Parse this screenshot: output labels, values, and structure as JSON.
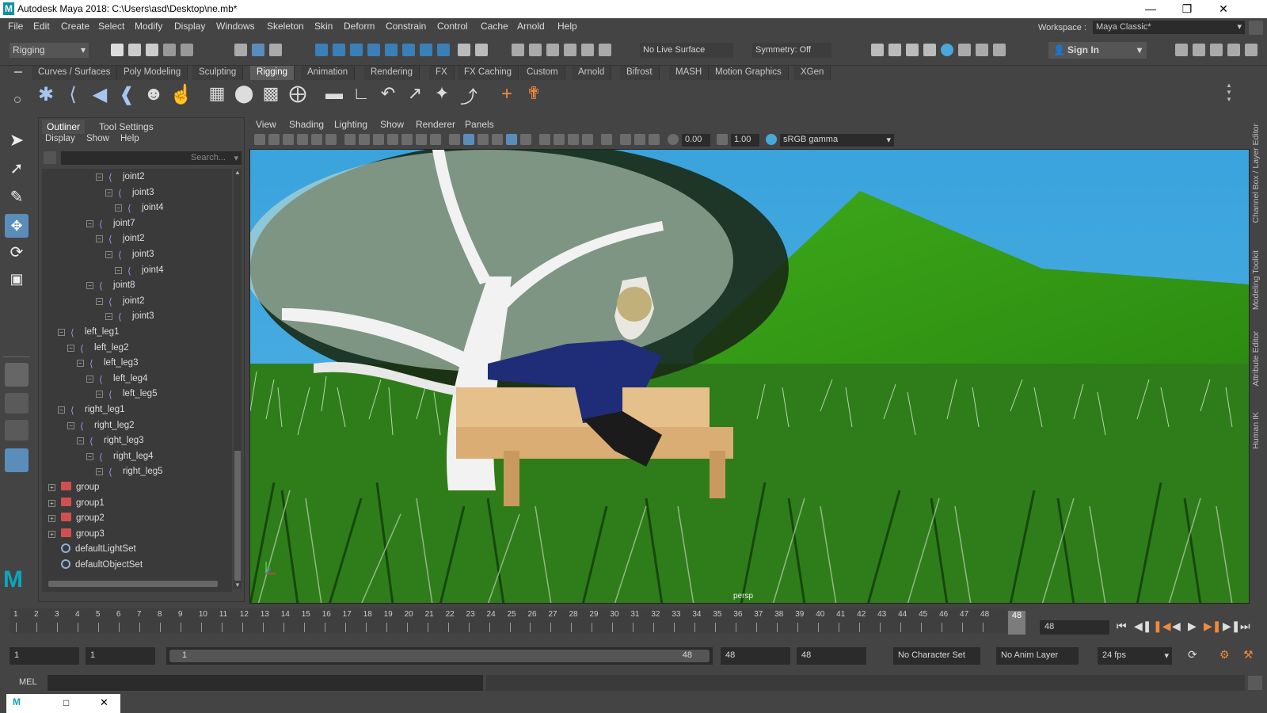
{
  "window": {
    "title": "Autodesk Maya 2018: C:\\Users\\asd\\Desktop\\ne.mb*",
    "logo": "M",
    "minimize_icon": "minimize-icon",
    "maximize_icon": "restore-icon",
    "close_icon": "close-icon"
  },
  "menubar": {
    "items": [
      "File",
      "Edit",
      "Create",
      "Select",
      "Modify",
      "Display",
      "Windows",
      "Skeleton",
      "Skin",
      "Deform",
      "Constrain",
      "Control",
      "Cache",
      "Arnold",
      "Help"
    ],
    "workspace_label": "Workspace :",
    "workspace_value": "Maya Classic*"
  },
  "statusline": {
    "mode": "Rigging",
    "live_surface": "No Live Surface",
    "symmetry": "Symmetry: Off",
    "sign_in": "Sign In"
  },
  "shelf": {
    "tabs": [
      "Curves / Surfaces",
      "Poly Modeling",
      "Sculpting",
      "Rigging",
      "Animation",
      "Rendering",
      "FX",
      "FX Caching",
      "Custom",
      "Arnold",
      "Bifrost",
      "MASH",
      "Motion Graphics",
      "XGen"
    ],
    "active_tab": "Rigging"
  },
  "outliner": {
    "tabs": [
      "Outliner",
      "Tool Settings"
    ],
    "menus": [
      "Display",
      "Show",
      "Help"
    ],
    "search_placeholder": "Search...",
    "rows": [
      {
        "label": "joint2",
        "type": "joint",
        "level": 5
      },
      {
        "label": "joint3",
        "type": "joint",
        "level": 6
      },
      {
        "label": "joint4",
        "type": "joint",
        "level": 7
      },
      {
        "label": "joint7",
        "type": "joint",
        "level": 4
      },
      {
        "label": "joint2",
        "type": "joint",
        "level": 5
      },
      {
        "label": "joint3",
        "type": "joint",
        "level": 6
      },
      {
        "label": "joint4",
        "type": "joint",
        "level": 7
      },
      {
        "label": "joint8",
        "type": "joint",
        "level": 4
      },
      {
        "label": "joint2",
        "type": "joint",
        "level": 5
      },
      {
        "label": "joint3",
        "type": "joint",
        "level": 6
      },
      {
        "label": "left_leg1",
        "type": "joint",
        "level": 1
      },
      {
        "label": "left_leg2",
        "type": "joint",
        "level": 2
      },
      {
        "label": "left_leg3",
        "type": "joint",
        "level": 3
      },
      {
        "label": "left_leg4",
        "type": "joint",
        "level": 4
      },
      {
        "label": "left_leg5",
        "type": "joint",
        "level": 5
      },
      {
        "label": "right_leg1",
        "type": "joint",
        "level": 1
      },
      {
        "label": "right_leg2",
        "type": "joint",
        "level": 2
      },
      {
        "label": "right_leg3",
        "type": "joint",
        "level": 3
      },
      {
        "label": "right_leg4",
        "type": "joint",
        "level": 4
      },
      {
        "label": "right_leg5",
        "type": "joint",
        "level": 5
      },
      {
        "label": "group",
        "type": "group",
        "level": 0
      },
      {
        "label": "group1",
        "type": "group",
        "level": 0
      },
      {
        "label": "group2",
        "type": "group",
        "level": 0
      },
      {
        "label": "group3",
        "type": "group",
        "level": 0
      },
      {
        "label": "defaultLightSet",
        "type": "set",
        "level": 0
      },
      {
        "label": "defaultObjectSet",
        "type": "set",
        "level": 0
      }
    ]
  },
  "viewport": {
    "menus": [
      "View",
      "Shading",
      "Lighting",
      "Show",
      "Renderer",
      "Panels"
    ],
    "exposure": "0.00",
    "gamma": "1.00",
    "color_space": "sRGB gamma",
    "camera_label": "persp"
  },
  "right_tabs": [
    "Channel Box / Layer Editor",
    "Modeling Toolkit",
    "Attribute Editor",
    "Human IK"
  ],
  "timeline": {
    "ticks": [
      "1",
      "2",
      "3",
      "4",
      "5",
      "6",
      "7",
      "8",
      "9",
      "10",
      "11",
      "12",
      "13",
      "14",
      "15",
      "16",
      "17",
      "18",
      "19",
      "20",
      "21",
      "22",
      "23",
      "24",
      "25",
      "26",
      "27",
      "28",
      "29",
      "30",
      "31",
      "32",
      "33",
      "34",
      "35",
      "36",
      "37",
      "38",
      "39",
      "40",
      "41",
      "42",
      "43",
      "44",
      "45",
      "46",
      "47",
      "48"
    ],
    "current_frame_marker": "48",
    "current_frame": "48"
  },
  "range": {
    "start": "1",
    "playback_start": "1",
    "bar_start": "1",
    "bar_end": "48",
    "playback_end": "48",
    "end": "48",
    "character_set": "No Character Set",
    "anim_layer": "No Anim Layer",
    "fps": "24 fps"
  },
  "cmdline": {
    "label": "MEL"
  }
}
